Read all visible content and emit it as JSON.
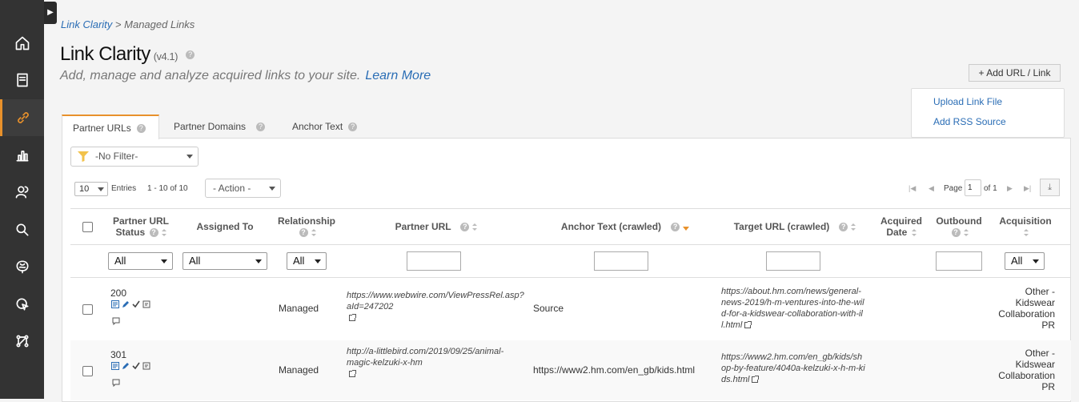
{
  "breadcrumb": {
    "root": "Link Clarity",
    "separator": ">",
    "current": "Managed Links"
  },
  "header": {
    "title": "Link Clarity",
    "version": "(v4.1)",
    "subtitle": "Add, manage and analyze acquired links to your site.",
    "learn_more": "Learn More",
    "add_button": "+ Add URL / Link"
  },
  "add_menu": [
    "Upload Link File",
    "Add RSS Source"
  ],
  "sidebar": {
    "items": [
      "home-icon",
      "document-icon",
      "link-icon",
      "chart-icon",
      "users-icon",
      "search-icon",
      "brain-icon",
      "cursor-target-icon",
      "network-icon"
    ],
    "active": "link-icon",
    "accent": "#e8912b"
  },
  "tabs": [
    {
      "label": "Partner URLs",
      "active": true
    },
    {
      "label": "Partner Domains",
      "active": false
    },
    {
      "label": "Anchor Text",
      "active": false
    }
  ],
  "filter": {
    "value": "-No Filter-"
  },
  "toolbar": {
    "entries_value": "10",
    "entries_label": "Entries",
    "range": "1 - 10 of 10",
    "action": "- Action -",
    "page_label": "Page",
    "page_value": "1",
    "of_label": "of 1"
  },
  "columns": {
    "status": "Partner URL Status",
    "assigned": "Assigned To",
    "relationship": "Relationship",
    "partner_url": "Partner URL",
    "anchor": "Anchor Text (crawled)",
    "target": "Target URL (crawled)",
    "acquired": "Acquired Date",
    "outbound": "Outbound",
    "acquisition": "Acquisition"
  },
  "column_filters": {
    "status": "All",
    "assigned": "All",
    "relationship": "All",
    "acquisition": "All"
  },
  "rows": [
    {
      "status": "200",
      "relationship": "Managed",
      "partner_url": "https://www.webwire.com/ViewPressRel.asp?aId=247202",
      "anchor": "Source",
      "target": "https://about.hm.com/news/general-news-2019/h-m-ventures-into-the-wild-for-a-kidswear-collaboration-with-ill.html",
      "acquisition": "Other - Kidswear Collaboration PR"
    },
    {
      "status": "301",
      "relationship": "Managed",
      "partner_url": "http://a-littlebird.com/2019/09/25/animal-magic-kelzuki-x-hm",
      "anchor": "https://www2.hm.com/en_gb/kids.html",
      "target": "https://www2.hm.com/en_gb/kids/shop-by-feature/4040a-kelzuki-x-h-m-kids.html",
      "acquisition": "Other - Kidswear Collaboration PR"
    }
  ]
}
